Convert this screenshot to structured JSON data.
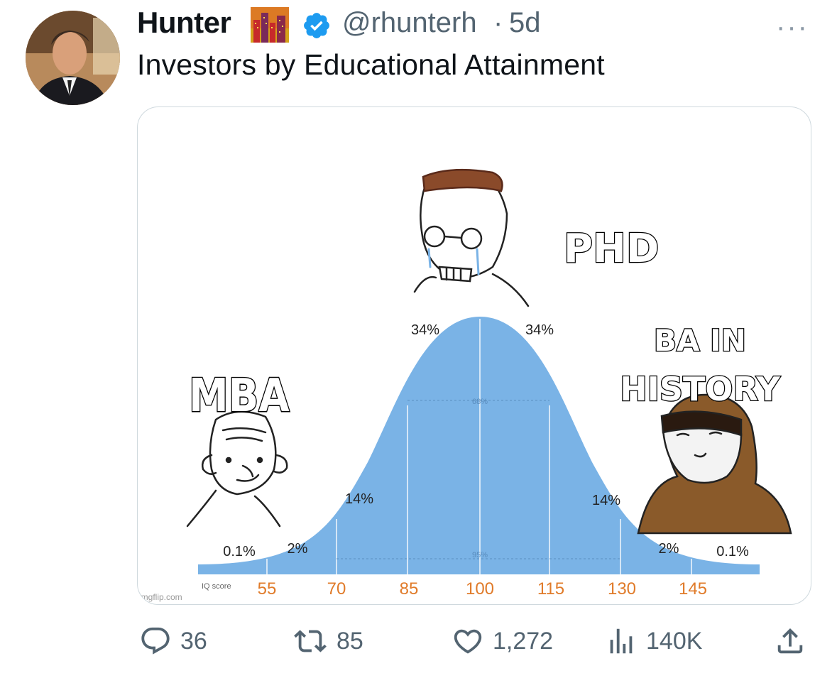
{
  "tweet": {
    "author_name": "Hunter",
    "handle": "@rhunterh",
    "separator": "·",
    "time": "5d",
    "more_label": "···",
    "text": "Investors by Educational Attainment"
  },
  "meme": {
    "labels": {
      "mba": "MBA",
      "phd": "PHD",
      "ba_line1": "BA IN",
      "ba_line2": "HISTORY"
    },
    "watermark": "imgflip.com",
    "axis_caption": "IQ score",
    "ticks": [
      "55",
      "70",
      "85",
      "100",
      "115",
      "130",
      "145"
    ],
    "percents": [
      "0.1%",
      "2%",
      "14%",
      "34%",
      "34%",
      "14%",
      "2%",
      "0.1%"
    ],
    "inner_labels": [
      "68%",
      "95%"
    ],
    "colors": {
      "curve": "#7ab3e6",
      "tick_text": "#e07b2a"
    }
  },
  "actions": {
    "replies": "36",
    "retweets": "85",
    "likes": "1,272",
    "views": "140K"
  },
  "colors": {
    "verified": "#1d9bf0",
    "muted": "#536471"
  }
}
